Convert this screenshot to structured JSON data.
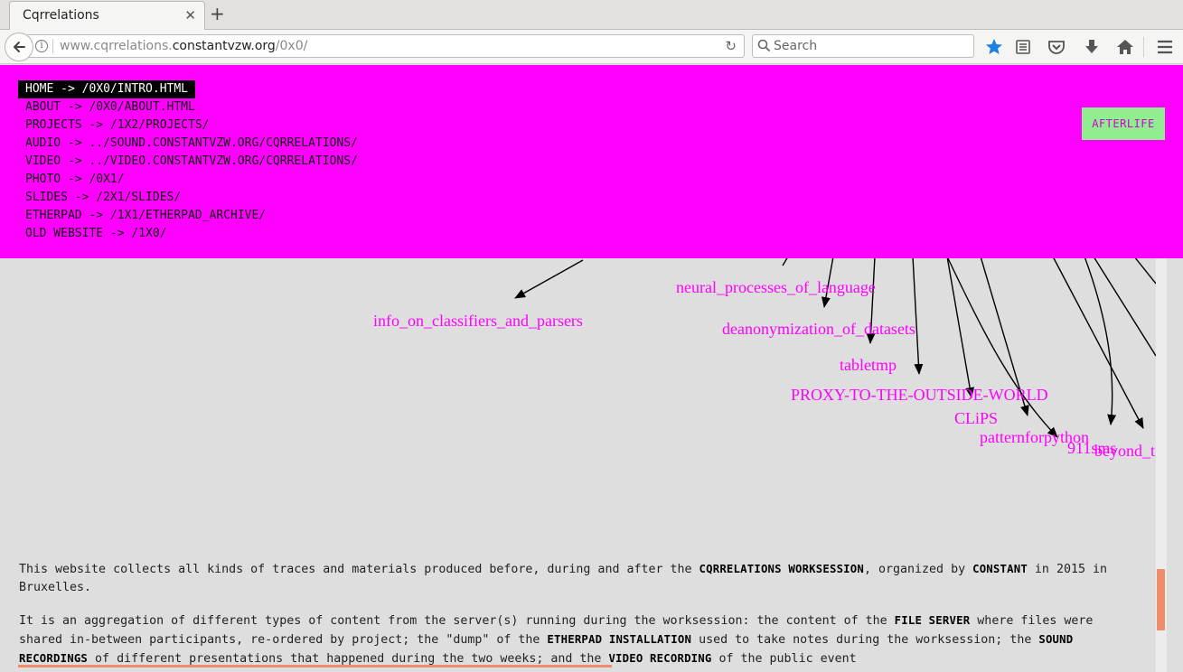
{
  "browser": {
    "tab_title": "Cqrrelations",
    "tab_close": "✕",
    "new_tab": "+",
    "url_prefix": "www.cqrrelations.",
    "url_domain": "constantvzw.org",
    "url_path": "/0x0/",
    "search_placeholder": "Search",
    "reload_glyph": "↻",
    "icons": [
      "back-arrow-icon",
      "info-icon",
      "reload-icon",
      "search-icon",
      "bookmark-star-icon",
      "reader-view-icon",
      "pocket-icon",
      "download-icon",
      "home-icon",
      "hamburger-menu-icon"
    ],
    "accent_star": "#1d7fe2"
  },
  "nav": {
    "items": [
      {
        "label": "HOME -> /0X0/INTRO.HTML",
        "active": true
      },
      {
        "label": "ABOUT -> /0X0/ABOUT.HTML",
        "active": false
      },
      {
        "label": "PROJECTS -> /1X2/PROJECTS/",
        "active": false
      },
      {
        "label": "AUDIO -> ../SOUND.CONSTANTVZW.ORG/CQRRELATIONS/",
        "active": false
      },
      {
        "label": "VIDEO -> ../VIDEO.CONSTANTVZW.ORG/CQRRELATIONS/",
        "active": false
      },
      {
        "label": "PHOTO -> /0X1/",
        "active": false
      },
      {
        "label": "SLIDES -> /2X1/SLIDES/",
        "active": false
      },
      {
        "label": "ETHERPAD -> /1X1/ETHERPAD_ARCHIVE/",
        "active": false
      },
      {
        "label": "OLD WEBSITE -> /1X0/",
        "active": false
      }
    ],
    "afterlife_label": "AFTERLIFE",
    "header_color": "#ff00ff",
    "afterlife_color": "#90ee90"
  },
  "graph": {
    "nodes": [
      "info_on_classifiers_and_parsers",
      "neural_processes_of_language",
      "deanonymization_of_datasets",
      "tabletmp",
      "PROXY-TO-THE-OUTSIDE-WORLD",
      "CLiPS",
      "patternforpython",
      "911sms",
      "beyond_t"
    ],
    "node_color": "#ff00ff"
  },
  "content": {
    "p1": {
      "t1": "This website collects all kinds of traces and materials produced before, during and after the ",
      "h1": "CQRRELATIONS WORKSESSION",
      "t2": ", organized by ",
      "h2": "CONSTANT",
      "t3": " in 2015 in Bruxelles."
    },
    "p2": {
      "t1": "It is an aggregation of different types of content from the server(s) running during the worksession: the content of the ",
      "h1": "FILE SERVER",
      "t2": " where files were shared in-between participants, re-ordered by project; the \"dump\" of the ",
      "h2": "ETHERPAD INSTALLATION",
      "t3": " used to take notes during the worksession; the ",
      "h3": "SOUND RECORDINGS",
      "t4": " of different presentations that happened during the two weeks; and the ",
      "h4": "VIDEO RECORDING",
      "t5": " of the public event"
    },
    "accent": "#ef8c6b"
  }
}
